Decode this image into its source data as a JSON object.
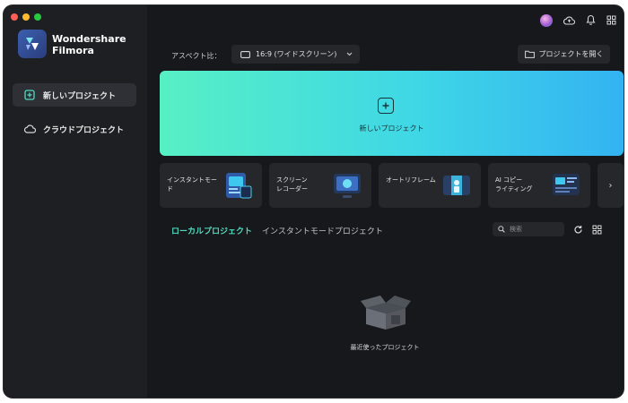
{
  "app": {
    "brand_line1": "Wondershare",
    "brand_line2": "Filmora"
  },
  "sidebar": {
    "items": [
      {
        "label": "新しいプロジェクト",
        "icon": "new-project-icon",
        "active": true
      },
      {
        "label": "クラウドプロジェクト",
        "icon": "cloud-icon",
        "active": false
      }
    ]
  },
  "toolbar": {
    "aspect_label": "アスペクト比：",
    "aspect_value": "16:9 (ワイドスクリーン)",
    "open_project_label": "プロジェクトを開く"
  },
  "hero": {
    "label": "新しいプロジェクト"
  },
  "modes": [
    {
      "label": "インスタントモード"
    },
    {
      "label": "スクリーン\nレコーダー"
    },
    {
      "label": "オートリフレーム"
    },
    {
      "label": "AI コピー\nライティング"
    }
  ],
  "more_arrow": "›",
  "tabs": [
    {
      "label": "ローカルプロジェクト",
      "active": true
    },
    {
      "label": "インスタントモードプロジェクト",
      "active": false
    }
  ],
  "search": {
    "placeholder": "検索"
  },
  "empty_state": {
    "label": "最近使ったプロジェクト"
  },
  "colors": {
    "accent": "#4fdcc0",
    "hero_gradient_start": "#57f0c4",
    "hero_gradient_end": "#33b3f2",
    "window_bg": "#17181b",
    "sidebar_bg": "#1e1f22",
    "card_bg": "#26272b"
  }
}
